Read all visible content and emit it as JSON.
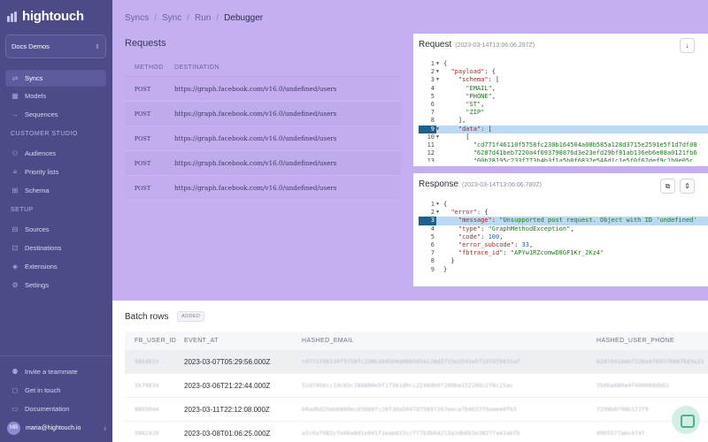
{
  "app": {
    "name": "hightouch"
  },
  "workspace": {
    "name": "Docs Demos",
    "chevron": "⌃⌄"
  },
  "sidebar": {
    "items": [
      {
        "label": "Syncs",
        "icon": "syncs-icon",
        "glyph": "⇄"
      },
      {
        "label": "Models",
        "icon": "models-icon",
        "glyph": "▦"
      },
      {
        "label": "Sequences",
        "icon": "sequences-icon",
        "glyph": "→"
      }
    ],
    "customer_studio_label": "CUSTOMER STUDIO",
    "studio_items": [
      {
        "label": "Audiences",
        "icon": "audiences-icon",
        "glyph": "⚇"
      },
      {
        "label": "Priority lists",
        "icon": "priority-lists-icon",
        "glyph": "≡"
      },
      {
        "label": "Schema",
        "icon": "schema-icon",
        "glyph": "⊞"
      }
    ],
    "setup_label": "SETUP",
    "setup_items": [
      {
        "label": "Sources",
        "icon": "sources-icon",
        "glyph": "⊟"
      },
      {
        "label": "Destinations",
        "icon": "destinations-icon",
        "glyph": "⊡"
      },
      {
        "label": "Extensions",
        "icon": "extensions-icon",
        "glyph": "◈"
      },
      {
        "label": "Settings",
        "icon": "settings-icon",
        "glyph": "⚙"
      }
    ],
    "bottom_items": [
      {
        "label": "Invite a teammate",
        "icon": "invite-icon",
        "glyph": "⚉"
      },
      {
        "label": "Get in touch",
        "icon": "chat-icon",
        "glyph": "◻"
      },
      {
        "label": "Documentation",
        "icon": "documentation-icon",
        "glyph": "▭"
      }
    ],
    "user": {
      "initials": "MB",
      "email": "maria@hightouch.io"
    }
  },
  "breadcrumb": {
    "items": [
      "Syncs",
      "Sync",
      "Run"
    ],
    "current": "Debugger",
    "separator": "/"
  },
  "requests": {
    "title": "Requests",
    "columns": [
      "METHOD",
      "DESTINATION"
    ],
    "rows": [
      {
        "method": "POST",
        "destination": "https://graph.facebook.com/v16.0/undefined/users"
      },
      {
        "method": "POST",
        "destination": "https://graph.facebook.com/v16.0/undefined/users"
      },
      {
        "method": "POST",
        "destination": "https://graph.facebook.com/v16.0/undefined/users"
      },
      {
        "method": "POST",
        "destination": "https://graph.facebook.com/v16.0/undefined/users"
      },
      {
        "method": "POST",
        "destination": "https://graph.facebook.com/v16.0/undefined/users"
      }
    ]
  },
  "request_panel": {
    "title": "Request",
    "timestamp": "(2023-03-14T13:06:06.297Z)",
    "download_icon": "download-icon"
  },
  "response_panel": {
    "title": "Response",
    "timestamp": "(2023-03-14T13:06:06.780Z)",
    "copy_icon": "copy-icon",
    "expand_icon": "expand-icon"
  },
  "batch": {
    "title": "Batch rows",
    "badge": "ADDED",
    "columns": [
      "FB_USER_ID",
      "EVENT_AT",
      "HASHED_EMAIL",
      "HASHED_USER_PHONE"
    ],
    "rows": [
      {
        "id": "5854615",
        "event_at": "2023-03-07T05:29:56.000Z",
        "email": "cd771f46110f5758fc230b164504a08b585a128d3715e2591e5f1d7df0835af",
        "phone": "6287d41beb7220a4f093798876d3e23"
      },
      {
        "id": "1679834",
        "event_at": "2023-03-06T21:22:44.000Z",
        "email": "52d74b8cc14c83c188880e5f1f581d0cc2248db9f280be232286c2f8c25ac",
        "phone": "350ba680a4f480068db61"
      },
      {
        "id": "8865044",
        "event_at": "2023-03-11T22:12:08.000Z",
        "email": "b0ad6d29ab6880ecd3688fc28f38a5047d75897267eeca7b4633f0aaee0fb3",
        "phone": "7298b8f98b172f9"
      },
      {
        "id": "5962429",
        "event_at": "2023-03-08T01:06:25.000Z",
        "email": "a3c0af083cfe66a8d1e0d1f1eab833ccff7b3b64213a3db6b3e3827fa41abfb",
        "phone": "09b5577a6c4f4f"
      }
    ]
  }
}
